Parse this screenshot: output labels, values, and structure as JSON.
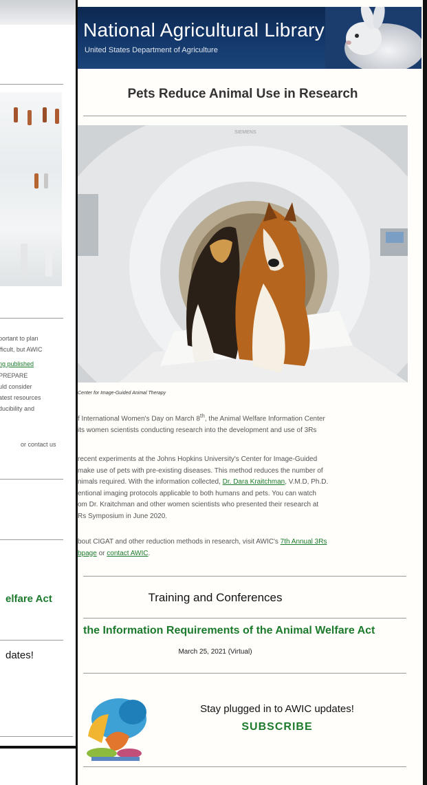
{
  "back_page": {
    "text_lines": [
      "portant to plan",
      "fficult, but AWIC",
      "ng published",
      "PREPARE",
      "uld consider",
      "atest resources",
      "ducibility and",
      "or contact us"
    ],
    "green_title": "elfare Act",
    "dark_title": "dates!"
  },
  "banner": {
    "title": "National Agricultural Library",
    "subtitle": "United States Department of Agriculture"
  },
  "article": {
    "headline": "Pets Reduce Animal Use in Research",
    "photo_label": "SIEMENS",
    "caption": "Center for Image-Guided Animal Therapy",
    "para1": {
      "l1_pre": "f International Women's Day on March 8",
      "l1_sup": "th",
      "l1_post": ", the Animal Welfare Information Center",
      "l2": "its women scientists conducting research into the development and use of 3Rs"
    },
    "para2": {
      "l1": "recent experiments at the Johns Hopkins University's Center for Image-Guided",
      "l2": "make use of pets with pre-existing diseases. This method reduces the number of",
      "l3_pre": "nimals required. With the information collected, ",
      "l3_link": "Dr. Dara Kraitchman",
      "l3_post": ", V.M.D, Ph.D.",
      "l4": "entional imaging protocols applicable to both humans and pets. You can watch",
      "l5": "om Dr. Kraitchman and other women scientists who presented their research at",
      "l6": "Rs Symposium in June 2020."
    },
    "para3": {
      "l1_pre": "bout CIGAT and other reduction methods in research, visit AWIC's ",
      "l1_link": "7th Annual 3Rs",
      "l2_link": "bpage",
      "l2_mid": " or ",
      "l2_link2": "contact AWIC",
      "l2_post": "."
    }
  },
  "training": {
    "section_title": "Training and Conferences",
    "event_title": "the Information Requirements of the Animal Welfare Act",
    "event_date": "March 25, 2021 (Virtual)"
  },
  "footer": {
    "stay": "Stay plugged in to AWIC updates!",
    "subscribe": "SUBSCRIBE"
  }
}
